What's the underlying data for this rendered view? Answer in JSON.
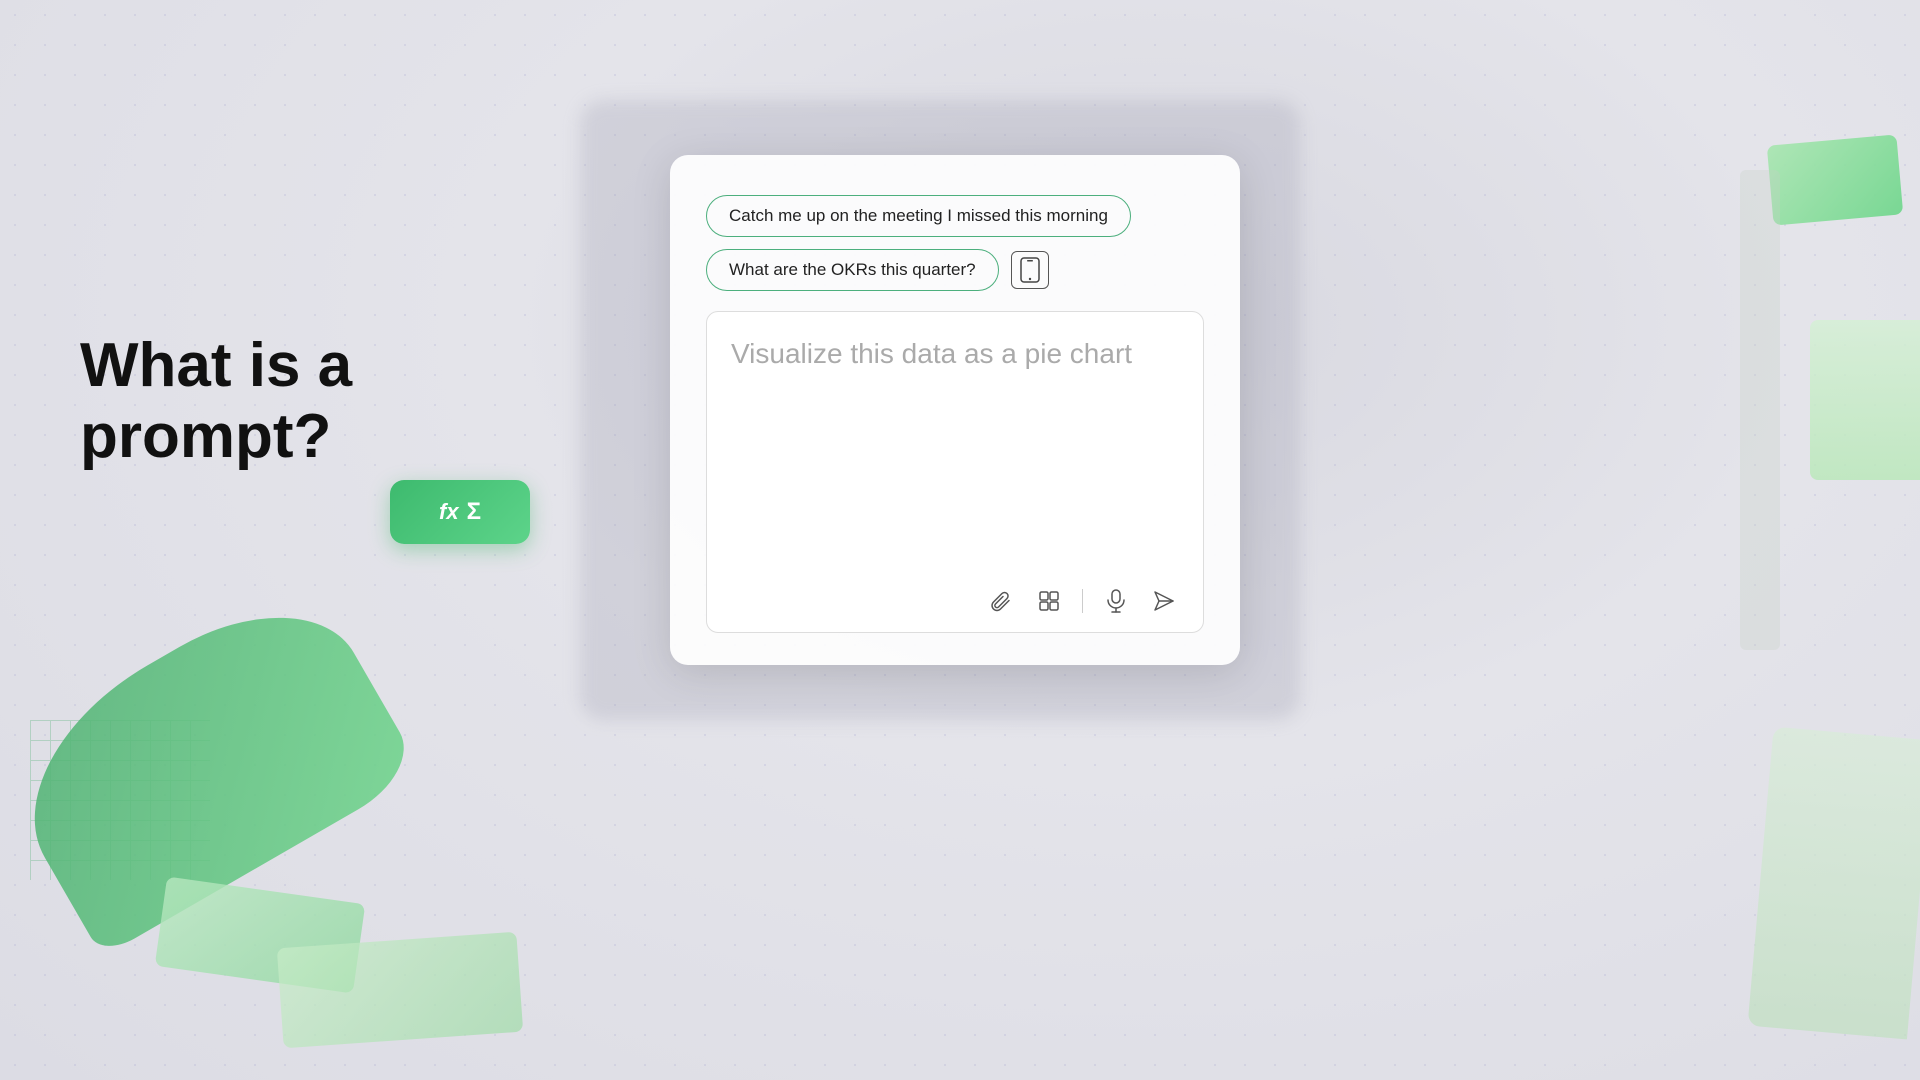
{
  "background": {
    "color": "#e4e4ea"
  },
  "heading": {
    "text": "What is a prompt?"
  },
  "bubbles": [
    {
      "id": "bubble-1",
      "text": "Catch me up on the meeting I missed this morning"
    },
    {
      "id": "bubble-2",
      "text": "What are the OKRs this quarter?"
    }
  ],
  "input": {
    "placeholder": "Visualize this data as a pie chart"
  },
  "formula_button": {
    "fx_label": "fx",
    "sigma_label": "Σ"
  },
  "toolbar_icons": {
    "attach": "📎",
    "grid": "⊞",
    "mic": "🎤",
    "send": "➤"
  }
}
